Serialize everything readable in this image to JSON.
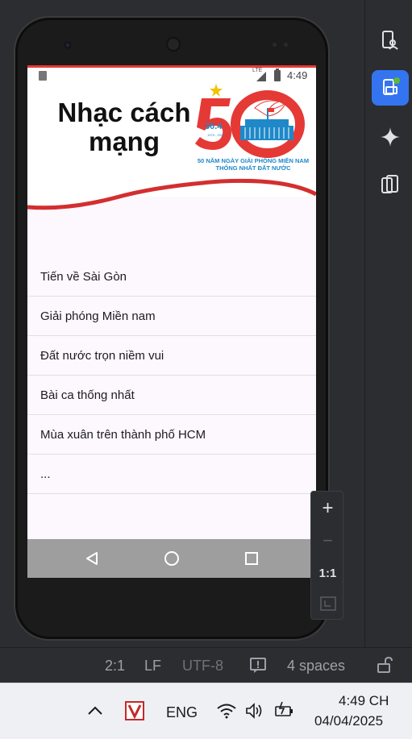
{
  "ide": {
    "status": {
      "position": "2:1",
      "line_ending": "LF",
      "encoding": "UTF-8",
      "indent": "4 spaces"
    },
    "right_toolbar": [
      "running-devices-icon",
      "device-manager-icon",
      "gemini-icon",
      "device-mirror-icon"
    ],
    "zoom": {
      "plus": "+",
      "minus": "−",
      "one_to_one": "1:1"
    }
  },
  "device": {
    "status_bar": {
      "time": "4:49",
      "network": "LTE"
    },
    "app": {
      "title": "Nhạc cách mạng",
      "logo": {
        "number": "50",
        "date": "30.4",
        "years": "1975 - 2025",
        "line1": "50 NĂM NGÀY GIẢI PHÓNG MIỀN NAM",
        "line2": "THỐNG NHẤT ĐẤT NƯỚC"
      },
      "songs": [
        "Tiến về Sài Gòn",
        "Giải phóng Miền nam",
        "Đất nước trọn niềm vui",
        "Bài ca thống nhất",
        "Mùa xuân trên thành phố HCM",
        "..."
      ]
    }
  },
  "taskbar": {
    "language": "ENG",
    "time": "4:49 CH",
    "date": "04/04/2025"
  },
  "colors": {
    "accent_red": "#e53935",
    "ide_blue": "#3574f0",
    "logo_blue": "#1e88c8"
  }
}
